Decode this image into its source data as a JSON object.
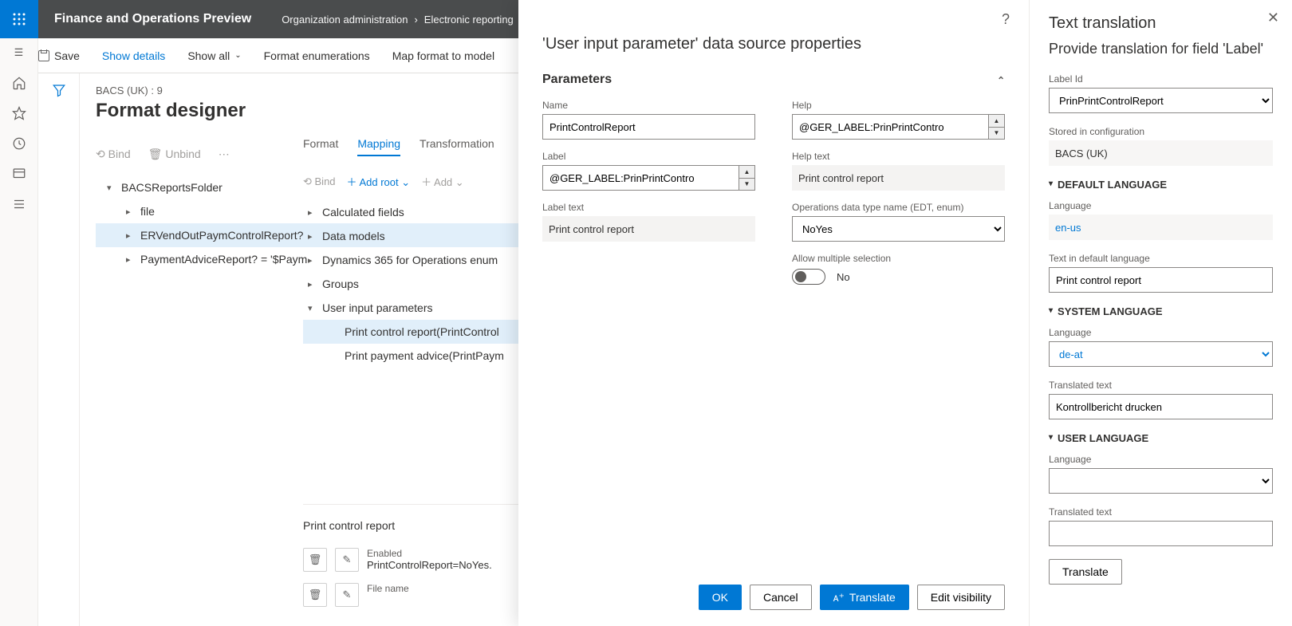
{
  "header": {
    "brand": "Finance and Operations Preview",
    "breadcrumbs": [
      "Organization administration",
      "Electronic reporting"
    ]
  },
  "actionbar": {
    "save": "Save",
    "showDetails": "Show details",
    "showAll": "Show all",
    "formatEnum": "Format enumerations",
    "mapFormat": "Map format to model"
  },
  "designer": {
    "subtitle": "BACS (UK) : 9",
    "title": "Format designer",
    "tb": {
      "bind": "Bind",
      "unbind": "Unbind"
    },
    "tree": [
      {
        "label": "BACSReportsFolder",
        "level": 0,
        "open": true
      },
      {
        "label": "file",
        "level": 1,
        "open": false
      },
      {
        "label": "ERVendOutPaymControlReport?",
        "level": 1,
        "open": false,
        "sel": true
      },
      {
        "label": "PaymentAdviceReport? = '$Paym",
        "level": 1,
        "open": false
      }
    ]
  },
  "rightcol": {
    "tabs": {
      "format": "Format",
      "mapping": "Mapping",
      "transformations": "Transformation"
    },
    "bind": "Bind",
    "addroot": "Add root",
    "add": "Add",
    "dslist": [
      {
        "label": "Calculated fields"
      },
      {
        "label": "Data models"
      },
      {
        "label": "Dynamics 365 for Operations enum"
      },
      {
        "label": "Groups"
      },
      {
        "label": "User input parameters",
        "open": true
      },
      {
        "label": "Print control report(PrintControl",
        "child": true,
        "sel": true
      },
      {
        "label": "Print payment advice(PrintPaym",
        "child": true
      }
    ]
  },
  "lower": {
    "title": "Print control report",
    "rows": [
      {
        "label": "Enabled",
        "value": "PrintControlReport=NoYes."
      },
      {
        "label": "File name",
        "value": ""
      }
    ]
  },
  "props": {
    "heading": "'User input parameter' data source properties",
    "section": "Parameters",
    "name_label": "Name",
    "name": "PrintControlReport",
    "label_label": "Label",
    "label": "@GER_LABEL:PrinPrintContro",
    "labeltext_label": "Label text",
    "labeltext": "Print control report",
    "help_label": "Help",
    "help": "@GER_LABEL:PrinPrintContro",
    "helptext_label": "Help text",
    "helptext": "Print control report",
    "opstype_label": "Operations data type name (EDT, enum)",
    "opstype": "NoYes",
    "allowmulti_label": "Allow multiple selection",
    "allowmulti": "No",
    "buttons": {
      "ok": "OK",
      "cancel": "Cancel",
      "translate": "Translate",
      "edit": "Edit visibility"
    }
  },
  "translate": {
    "h1": "Text translation",
    "h2": "Provide translation for field 'Label'",
    "labelid_label": "Label Id",
    "labelid": "PrinPrintControlReport",
    "stored_label": "Stored in configuration",
    "stored": "BACS (UK)",
    "def_section": "DEFAULT LANGUAGE",
    "def_lang_label": "Language",
    "def_lang": "en-us",
    "def_text_label": "Text in default language",
    "def_text": "Print control report",
    "sys_section": "SYSTEM LANGUAGE",
    "sys_lang_label": "Language",
    "sys_lang": "de-at",
    "sys_text_label": "Translated text",
    "sys_text": "Kontrollbericht drucken",
    "user_section": "USER LANGUAGE",
    "user_lang_label": "Language",
    "user_text_label": "Translated text",
    "translate_btn": "Translate"
  }
}
